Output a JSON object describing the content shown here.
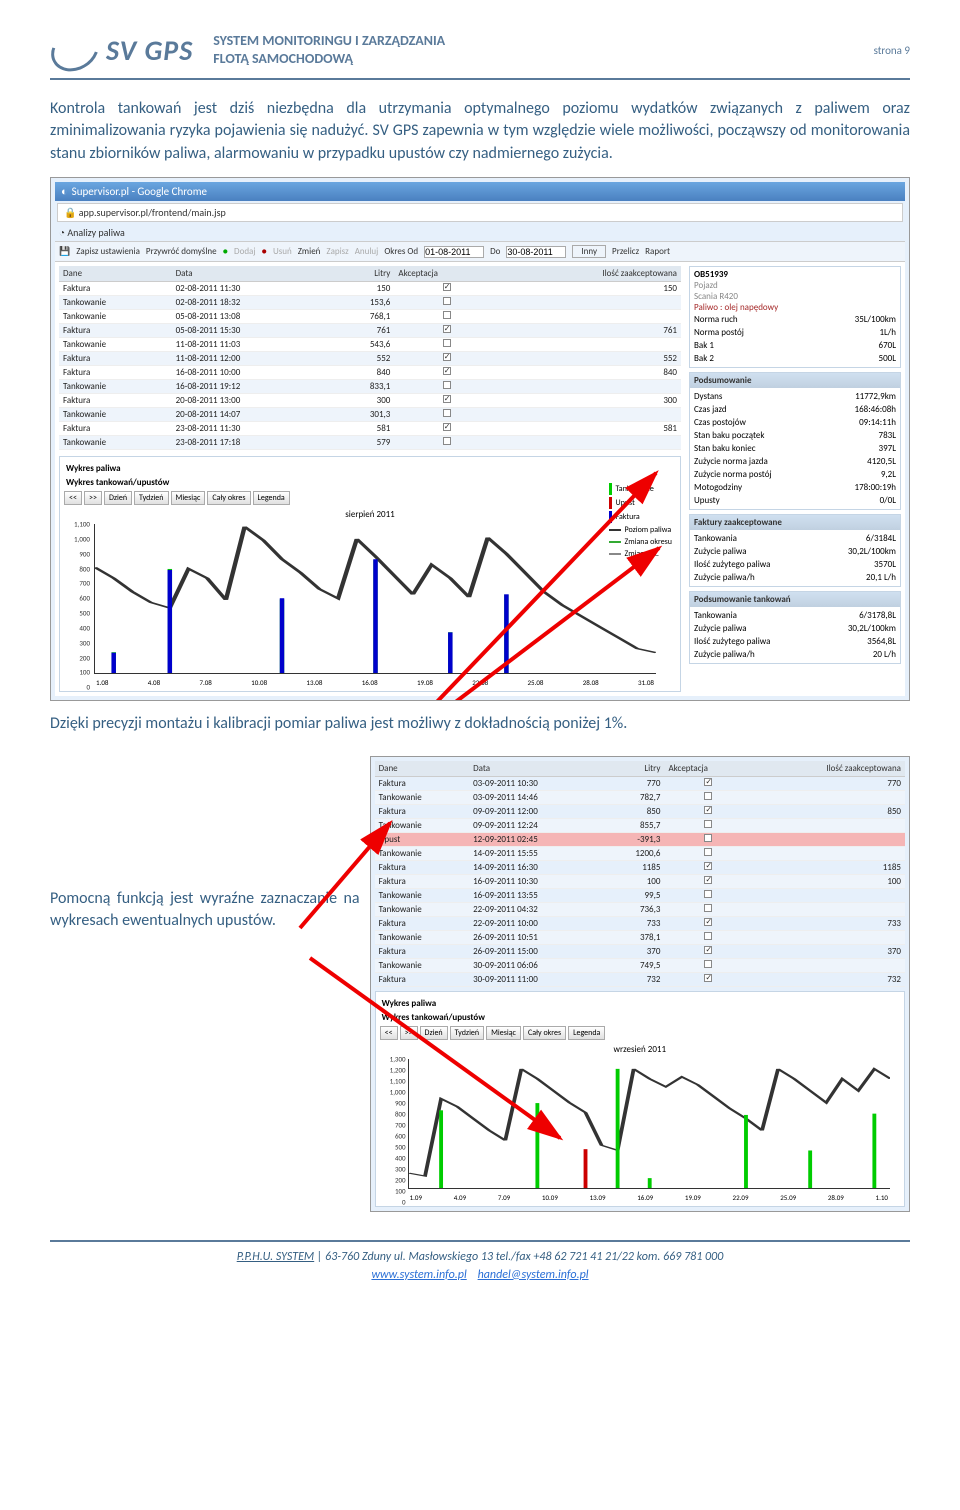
{
  "header": {
    "logo_text": "SV GPS",
    "title_line1": "SYSTEM MONITORINGU I ZARZĄDZANIA",
    "title_line2": "FLOTĄ SAMOCHODOWĄ",
    "page_label": "strona 9"
  },
  "para1": "Kontrola tankowań jest dziś niezbędna dla utrzymania optymalnego poziomu wydatków związanych z paliwem oraz zminimalizowania ryzyka pojawienia się nadużyć. SV GPS zapewnia w tym względzie wiele możliwości, począwszy od monitorowania stanu zbiorników paliwa, alarmowaniu w przypadku upustów czy nadmiernego zużycia.",
  "para2": "Dzięki precyzji montażu i kalibracji pomiar paliwa jest możliwy z dokładnością poniżej 1%.",
  "para3": "Pomocną funkcją jest wyraźne zaznaczanie na wykresach ewentualnych upustów.",
  "shot1": {
    "window_title": "Supervisor.pl - Google Chrome",
    "url": "app.supervisor.pl/frontend/main.jsp",
    "tab": "Analizy paliwa",
    "toolbar": {
      "zapisz_ust": "Zapisz ustawienia",
      "przywroc": "Przywróć domyślne",
      "dodaj": "Dodaj",
      "usun": "Usuń",
      "zmien": "Zmień",
      "zapisz": "Zapisz",
      "anuluj": "Anuluj",
      "okres_od": "Okres Od",
      "date_from": "01-08-2011",
      "do": "Do",
      "date_to": "30-08-2011",
      "inny": "Inny",
      "przelicz": "Przelicz",
      "raport": "Raport"
    },
    "cols": {
      "dane": "Dane",
      "data": "Data",
      "litry": "Litry",
      "akc": "Akceptacja",
      "ilosc": "Ilość zaakceptowana"
    },
    "rows": [
      {
        "dane": "Faktura",
        "data": "02-08-2011 11:30",
        "litry": "150",
        "chk": true,
        "ilosc": "150"
      },
      {
        "dane": "Tankowanie",
        "data": "02-08-2011 18:32",
        "litry": "153,6",
        "chk": false,
        "ilosc": ""
      },
      {
        "dane": "Tankowanie",
        "data": "05-08-2011 13:08",
        "litry": "768,1",
        "chk": false,
        "ilosc": ""
      },
      {
        "dane": "Faktura",
        "data": "05-08-2011 15:30",
        "litry": "761",
        "chk": true,
        "ilosc": "761"
      },
      {
        "dane": "Tankowanie",
        "data": "11-08-2011 11:03",
        "litry": "543,6",
        "chk": false,
        "ilosc": ""
      },
      {
        "dane": "Faktura",
        "data": "11-08-2011 12:00",
        "litry": "552",
        "chk": true,
        "ilosc": "552"
      },
      {
        "dane": "Faktura",
        "data": "16-08-2011 10:00",
        "litry": "840",
        "chk": true,
        "ilosc": "840"
      },
      {
        "dane": "Tankowanie",
        "data": "16-08-2011 19:12",
        "litry": "833,1",
        "chk": false,
        "ilosc": ""
      },
      {
        "dane": "Faktura",
        "data": "20-08-2011 13:00",
        "litry": "300",
        "chk": true,
        "ilosc": "300"
      },
      {
        "dane": "Tankowanie",
        "data": "20-08-2011 14:07",
        "litry": "301,3",
        "chk": false,
        "ilosc": ""
      },
      {
        "dane": "Faktura",
        "data": "23-08-2011 11:30",
        "litry": "581",
        "chk": true,
        "ilosc": "581"
      },
      {
        "dane": "Tankowanie",
        "data": "23-08-2011 17:18",
        "litry": "579",
        "chk": false,
        "ilosc": ""
      }
    ],
    "vehicle": {
      "id": "OB51939",
      "pojazd": "Pojazd",
      "model": "Scania R420",
      "paliwo": "Paliwo : olej napędowy"
    },
    "norms": [
      {
        "k": "Norma ruch",
        "v": "35L/100km"
      },
      {
        "k": "Norma postój",
        "v": "1L/h"
      },
      {
        "k": "Bak 1",
        "v": "670L"
      },
      {
        "k": "Bak 2",
        "v": "500L"
      }
    ],
    "pods_h": "Podsumowanie",
    "pods": [
      {
        "k": "Dystans",
        "v": "11772,9km"
      },
      {
        "k": "Czas jazd",
        "v": "168:46:08h"
      },
      {
        "k": "Czas postojów",
        "v": "09:14:11h"
      },
      {
        "k": "Stan baku początek",
        "v": "783L"
      },
      {
        "k": "Stan baku koniec",
        "v": "397L"
      },
      {
        "k": "Zużycie norma jazda",
        "v": "4120,5L"
      },
      {
        "k": "Zużycie norma postój",
        "v": "9,2L"
      },
      {
        "k": "Motogodziny",
        "v": "178:00:19h"
      },
      {
        "k": "Upusty",
        "v": "0/0L"
      }
    ],
    "fakt_h": "Faktury zaakceptowane",
    "fakt": [
      {
        "k": "Tankowania",
        "v": "6/3184L"
      },
      {
        "k": "Zużycie paliwa",
        "v": "30,2L/100km"
      },
      {
        "k": "Ilość zużytego paliwa",
        "v": "3570L"
      },
      {
        "k": "Zużycie paliwa/h",
        "v": "20,1 L/h"
      }
    ],
    "ptank_h": "Podsumowanie tankowań",
    "ptank": [
      {
        "k": "Tankowania",
        "v": "6/3178,8L"
      },
      {
        "k": "Zużycie paliwa",
        "v": "30,2L/100km"
      },
      {
        "k": "Ilość zużytego paliwa",
        "v": "3564,8L"
      },
      {
        "k": "Zużycie paliwa/h",
        "v": "20 L/h"
      }
    ],
    "chart": {
      "wyk_title": "Wykres paliwa",
      "title": "Wykres tankowań/upustów",
      "btns": {
        "prev": "<<",
        "next": ">>",
        "dzien": "Dzień",
        "tydzien": "Tydzień",
        "miesiac": "Miesiąc",
        "caly": "Cały okres",
        "legenda": "Legenda"
      },
      "caption": "sierpień 2011",
      "legend": {
        "tank": "Tankowanie",
        "upust": "Upust",
        "faktura": "Faktura",
        "poziom": "Poziom paliwa",
        "zmiana": "Zmiana okresu",
        "zmiana_sk": "Zmiana sk."
      },
      "xticks": [
        "1.08",
        "4.08",
        "7.08",
        "10.08",
        "13.08",
        "16.08",
        "19.08",
        "22.08",
        "25.08",
        "28.08",
        "31.08"
      ],
      "yticks": [
        "0",
        "100",
        "200",
        "300",
        "400",
        "500",
        "600",
        "700",
        "800",
        "900",
        "1,000",
        "1,100"
      ]
    }
  },
  "shot2": {
    "cols": {
      "dane": "Dane",
      "data": "Data",
      "litry": "Litry",
      "akc": "Akceptacja",
      "ilosc": "Ilość zaakceptowana"
    },
    "rows": [
      {
        "dane": "Faktura",
        "data": "03-09-2011 10:30",
        "litry": "770",
        "chk": true,
        "ilosc": "770",
        "cls": ""
      },
      {
        "dane": "Tankowanie",
        "data": "03-09-2011 14:46",
        "litry": "782,7",
        "chk": false,
        "ilosc": "",
        "cls": ""
      },
      {
        "dane": "Faktura",
        "data": "09-09-2011 12:00",
        "litry": "850",
        "chk": true,
        "ilosc": "850",
        "cls": ""
      },
      {
        "dane": "Tankowanie",
        "data": "09-09-2011 12:24",
        "litry": "855,7",
        "chk": false,
        "ilosc": "",
        "cls": ""
      },
      {
        "dane": "Upust",
        "data": "12-09-2011 02:45",
        "litry": "-391,3",
        "chk": false,
        "ilosc": "",
        "cls": "upust"
      },
      {
        "dane": "Tankowanie",
        "data": "14-09-2011 15:55",
        "litry": "1200,6",
        "chk": false,
        "ilosc": "",
        "cls": ""
      },
      {
        "dane": "Faktura",
        "data": "14-09-2011 16:30",
        "litry": "1185",
        "chk": true,
        "ilosc": "1185",
        "cls": ""
      },
      {
        "dane": "Faktura",
        "data": "16-09-2011 10:30",
        "litry": "100",
        "chk": true,
        "ilosc": "100",
        "cls": ""
      },
      {
        "dane": "Tankowanie",
        "data": "16-09-2011 13:55",
        "litry": "99,5",
        "chk": false,
        "ilosc": "",
        "cls": ""
      },
      {
        "dane": "Tankowanie",
        "data": "22-09-2011 04:32",
        "litry": "736,3",
        "chk": false,
        "ilosc": "",
        "cls": ""
      },
      {
        "dane": "Faktura",
        "data": "22-09-2011 10:00",
        "litry": "733",
        "chk": true,
        "ilosc": "733",
        "cls": ""
      },
      {
        "dane": "Tankowanie",
        "data": "26-09-2011 10:51",
        "litry": "378,1",
        "chk": false,
        "ilosc": "",
        "cls": ""
      },
      {
        "dane": "Faktura",
        "data": "26-09-2011 15:00",
        "litry": "370",
        "chk": true,
        "ilosc": "370",
        "cls": ""
      },
      {
        "dane": "Tankowanie",
        "data": "30-09-2011 06:06",
        "litry": "749,5",
        "chk": false,
        "ilosc": "",
        "cls": ""
      },
      {
        "dane": "Faktura",
        "data": "30-09-2011 11:00",
        "litry": "732",
        "chk": true,
        "ilosc": "732",
        "cls": ""
      }
    ],
    "chart": {
      "wyk_title": "Wykres paliwa",
      "title": "Wykres tankowań/upustów",
      "btns": {
        "prev": "<<",
        "next": ">>",
        "dzien": "Dzień",
        "tydzien": "Tydzień",
        "miesiac": "Miesiąc",
        "caly": "Cały okres",
        "legenda": "Legenda"
      },
      "caption": "wrzesień 2011",
      "xticks": [
        "1.09",
        "4.09",
        "7.09",
        "10.09",
        "13.09",
        "16.09",
        "19.09",
        "22.09",
        "25.09",
        "28.09",
        "1.10"
      ],
      "yticks": [
        "0",
        "100",
        "200",
        "300",
        "400",
        "500",
        "600",
        "700",
        "800",
        "900",
        "1,000",
        "1,100",
        "1,200",
        "1,300"
      ]
    }
  },
  "chart_data": [
    {
      "type": "line",
      "title": "sierpień 2011",
      "xlabel": "",
      "ylabel": "",
      "ylim": [
        0,
        1100
      ],
      "x": [
        "1.08",
        "4.08",
        "7.08",
        "10.08",
        "13.08",
        "16.08",
        "19.08",
        "22.08",
        "25.08",
        "28.08",
        "31.08"
      ],
      "series": [
        {
          "name": "Poziom paliwa",
          "values": [
            780,
            700,
            600,
            520,
            480,
            770,
            700,
            540,
            1080,
            980,
            840,
            740,
            620,
            550,
            990,
            860,
            720,
            580,
            800,
            700,
            560,
            1000,
            880,
            740,
            600,
            500,
            420,
            340,
            260,
            180,
            150
          ]
        }
      ],
      "events": [
        {
          "type": "Tankowanie",
          "x": "02-08",
          "value": 153.6
        },
        {
          "type": "Tankowanie",
          "x": "05-08",
          "value": 768.1
        },
        {
          "type": "Tankowanie",
          "x": "11-08",
          "value": 543.6
        },
        {
          "type": "Tankowanie",
          "x": "16-08",
          "value": 833.1
        },
        {
          "type": "Tankowanie",
          "x": "20-08",
          "value": 301.3
        },
        {
          "type": "Tankowanie",
          "x": "23-08",
          "value": 579
        },
        {
          "type": "Faktura",
          "x": "02-08",
          "value": 150
        },
        {
          "type": "Faktura",
          "x": "05-08",
          "value": 761
        },
        {
          "type": "Faktura",
          "x": "11-08",
          "value": 552
        },
        {
          "type": "Faktura",
          "x": "16-08",
          "value": 840
        },
        {
          "type": "Faktura",
          "x": "20-08",
          "value": 300
        },
        {
          "type": "Faktura",
          "x": "23-08",
          "value": 581
        }
      ]
    },
    {
      "type": "line",
      "title": "wrzesień 2011",
      "xlabel": "",
      "ylabel": "",
      "ylim": [
        0,
        1300
      ],
      "x": [
        "1.09",
        "4.09",
        "7.09",
        "10.09",
        "13.09",
        "16.09",
        "19.09",
        "22.09",
        "25.09",
        "28.09",
        "1.10"
      ],
      "series": [
        {
          "name": "Poziom paliwa",
          "values": [
            150,
            120,
            900,
            820,
            700,
            580,
            480,
            1200,
            1100,
            980,
            860,
            760,
            430,
            380,
            1200,
            1100,
            1020,
            1120,
            1040,
            920,
            800,
            700,
            580,
            1200,
            1100,
            980,
            860,
            1100,
            980,
            1200,
            1100
          ]
        }
      ],
      "events": [
        {
          "type": "Tankowanie",
          "x": "03-09",
          "value": 782.7
        },
        {
          "type": "Tankowanie",
          "x": "09-09",
          "value": 855.7
        },
        {
          "type": "Upust",
          "x": "12-09",
          "value": -391.3
        },
        {
          "type": "Tankowanie",
          "x": "14-09",
          "value": 1200.6
        },
        {
          "type": "Tankowanie",
          "x": "16-09",
          "value": 99.5
        },
        {
          "type": "Tankowanie",
          "x": "22-09",
          "value": 736.3
        },
        {
          "type": "Tankowanie",
          "x": "26-09",
          "value": 378.1
        },
        {
          "type": "Tankowanie",
          "x": "30-09",
          "value": 749.5
        }
      ]
    }
  ],
  "footer": {
    "line1a": "P.P.H.U. SYSTEM",
    "line1b": " | 63-760 Zduny   ul. Masłowskiego 13   tel./fax +48 62 721 41 21/22 kom. 669 781 000",
    "link1": "www.system.info.pl",
    "link2": "handel@system.info.pl"
  }
}
